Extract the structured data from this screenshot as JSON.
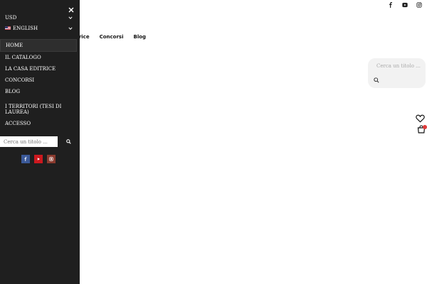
{
  "drawer": {
    "currency": "USD",
    "language": "ENGLISH",
    "menu": [
      {
        "label": "HOME",
        "active": true
      },
      {
        "label": "IL CATALOGO"
      },
      {
        "label": "LA CASA EDITRICE"
      },
      {
        "label": "CONCORSI"
      },
      {
        "label": "BLOG"
      },
      {
        "label": "I TERRITORI (TESI DI LAUREA)"
      },
      {
        "label": "ACCESSO"
      }
    ],
    "search_placeholder": "Cerca un titolo ...",
    "social": [
      "facebook-icon",
      "youtube-icon",
      "instagram-icon"
    ]
  },
  "header": {
    "social": [
      "facebook-icon",
      "youtube-icon",
      "instagram-icon"
    ],
    "nav": [
      "sa editrice",
      "Concorsi",
      "Blog"
    ],
    "search_placeholder": "Cerca un titolo ..."
  },
  "colors": {
    "drawer_bg": "#1f1f1f",
    "cart_badge": "#e03a3a",
    "facebook": "#3b5998",
    "youtube": "#cc181e",
    "instagram": "#8a3b2f"
  }
}
